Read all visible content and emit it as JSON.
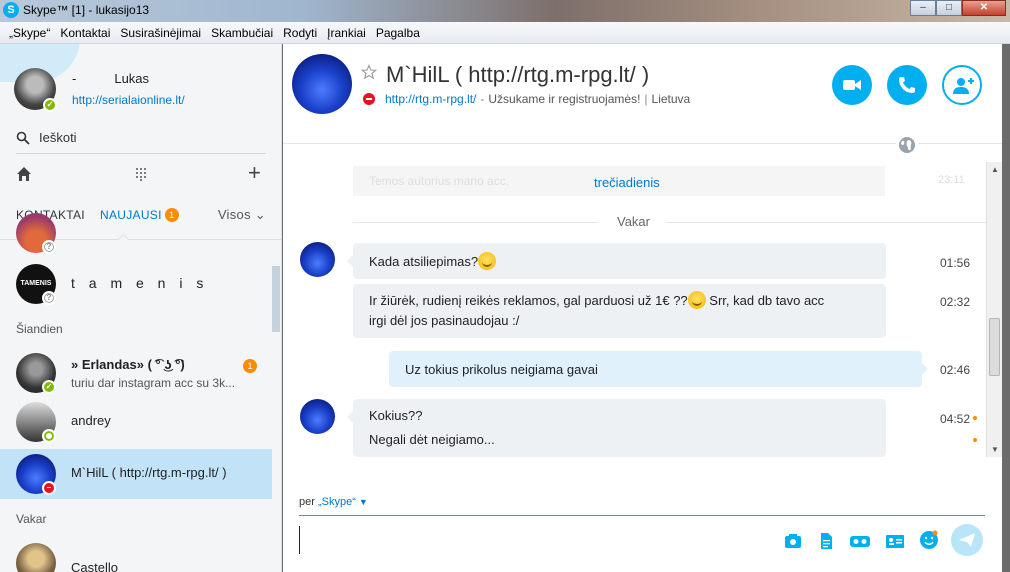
{
  "window": {
    "title": "Skype™ [1] - lukasijo13",
    "buttons": {
      "minimize": "–",
      "maximize": "□",
      "close": "✕"
    }
  },
  "menu": [
    "„Skype“",
    "Kontaktai",
    "Susirašinėjimai",
    "Skambučiai",
    "Rodyti",
    "Įrankiai",
    "Pagalba"
  ],
  "profile": {
    "dash": "-",
    "name": "Lukas",
    "mood_link": "http://serialaionline.lt/",
    "status": "online"
  },
  "search": {
    "placeholder": "Ieškoti"
  },
  "tabs": {
    "contacts": "KONTAKTAI",
    "recent": "NAUJAUSI",
    "recent_badge": "1",
    "filter": "Visos"
  },
  "contacts_list": {
    "tamenis": {
      "name": "t a m e n i s",
      "avatar_text": "TAMENIS"
    },
    "section_today": "Šiandien",
    "erlandas": {
      "name": "» Erlandas» ( ͡° ͜ʖ ͡°)",
      "message": "turiu dar instagram acc su 3k...",
      "badge": "1"
    },
    "andrey": {
      "name": "andrey"
    },
    "mhill": {
      "name": "M`HilL ( http://rtg.m-rpg.lt/ )"
    },
    "section_yesterday": "Vakar",
    "castello": {
      "name": "Castello"
    }
  },
  "chat": {
    "title": "M`HilL ( http://rtg.m-rpg.lt/ )",
    "link": "http://rtg.m-rpg.lt/",
    "mood": "Užsukame ir registruojamės!",
    "location": "Lietuva",
    "faded_text": "Temos autorius mano acc.",
    "faded_time": "23:11",
    "day_chip": "trečiadienis",
    "day_separator": "Vakar",
    "messages": [
      {
        "text": "Kada atsiliepimas?",
        "time": "01:56"
      },
      {
        "line1": "Ir žiūrėk, rudienį reikės reklamos, gal parduosi už 1€ ??",
        "line1b": "Srr, kad db tavo acc",
        "line2": "irgi dėl jos pasinaudojau :/",
        "time": "02:32"
      },
      {
        "text": "Uz tokius prikolus neigiama gavai",
        "time": "02:46"
      },
      {
        "line1": "Kokius??",
        "line2": "Negali dėt neigiamo...",
        "time": "04:52"
      }
    ]
  },
  "composer": {
    "via_prefix": "per",
    "via_service": "„Skype“",
    "placeholder": ""
  },
  "colors": {
    "accent": "#00aff0",
    "link": "#0078ca",
    "badge": "#ff8c00",
    "dnd": "#e81123",
    "online": "#7fba00"
  }
}
